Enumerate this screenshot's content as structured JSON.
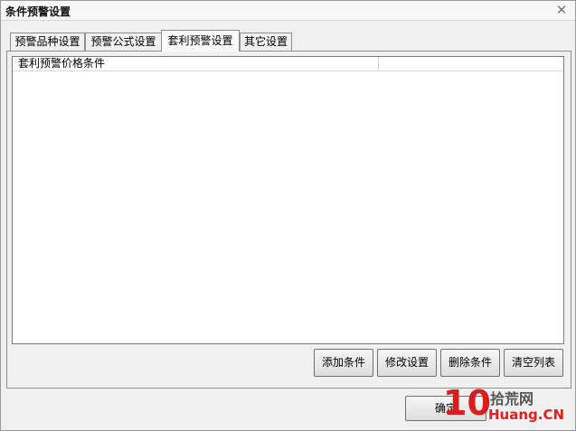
{
  "window": {
    "title": "条件预警设置",
    "close_glyph": "✕"
  },
  "tabs": [
    {
      "label": "预警品种设置",
      "active": false
    },
    {
      "label": "预警公式设置",
      "active": false
    },
    {
      "label": "套利预警设置",
      "active": true
    },
    {
      "label": "其它设置",
      "active": false
    }
  ],
  "list": {
    "columns": [
      "套利预警价格条件",
      ""
    ],
    "rows": []
  },
  "actions": {
    "add": "添加条件",
    "modify": "修改设置",
    "delete": "删除条件",
    "clear": "清空列表"
  },
  "footer": {
    "ok": "确定"
  },
  "watermark": {
    "num": "10",
    "cn": "拾荒网",
    "en": "Huang.CN"
  }
}
